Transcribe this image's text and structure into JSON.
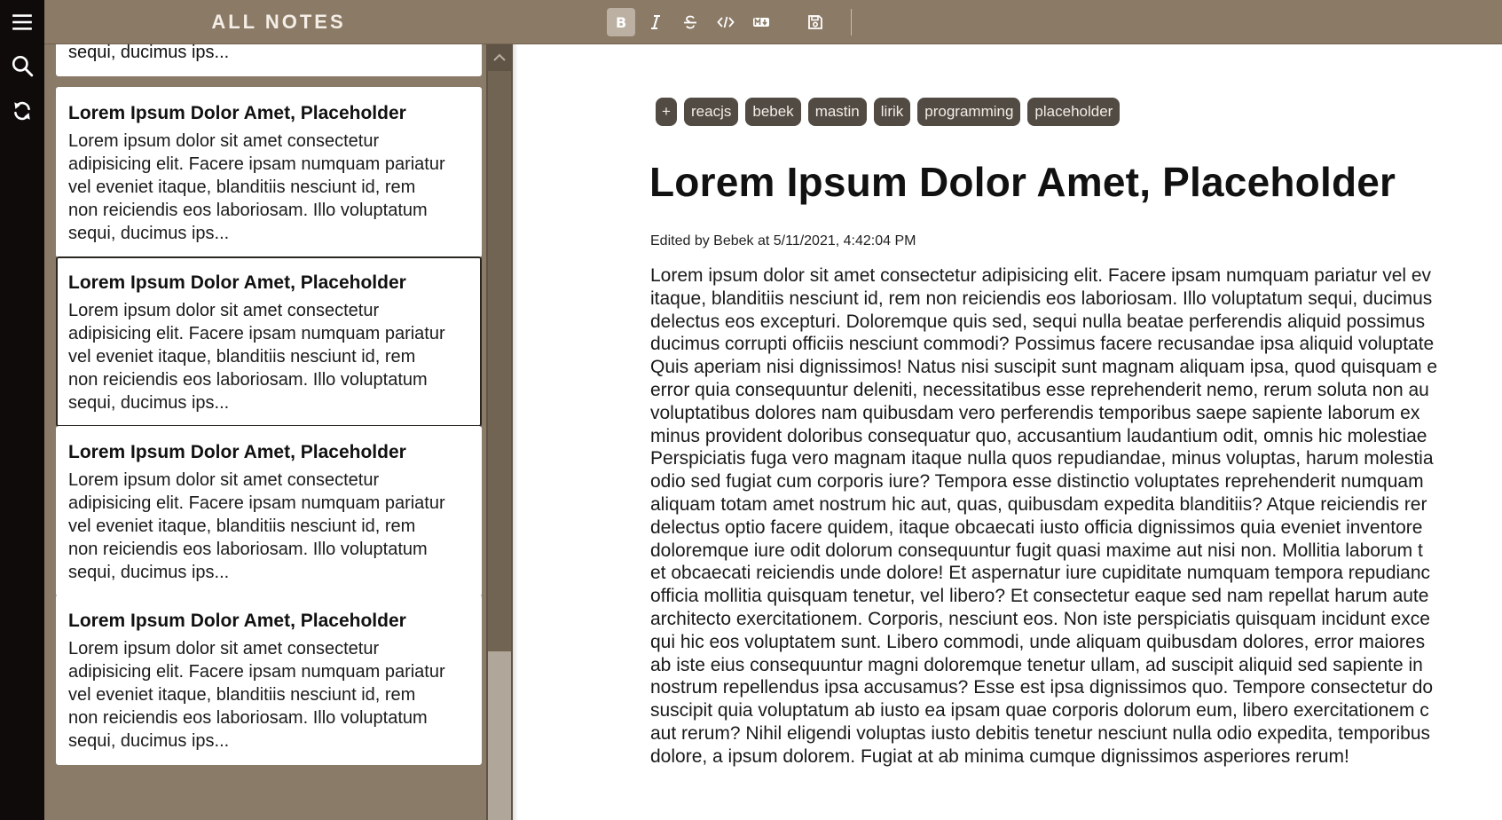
{
  "rail": {
    "icons": [
      "menu-icon",
      "search-icon",
      "sync-icon"
    ]
  },
  "list": {
    "title": "ALL NOTES",
    "partial_card_tail": "sequi, ducimus ips...",
    "cards": [
      {
        "title": "Lorem Ipsum Dolor Amet, Placeholder",
        "lines": [
          "Lorem ipsum dolor sit amet consectetur",
          "adipisicing elit. Facere ipsam numquam pariatur",
          "vel eveniet itaque, blanditiis nesciunt id, rem",
          "non reiciendis eos laboriosam. Illo voluptatum",
          "sequi, ducimus ips..."
        ],
        "active": false
      },
      {
        "title": "Lorem Ipsum Dolor Amet, Placeholder",
        "lines": [
          "Lorem ipsum dolor sit amet consectetur",
          "adipisicing elit. Facere ipsam numquam pariatur",
          "vel eveniet itaque, blanditiis nesciunt id, rem",
          "non reiciendis eos laboriosam. Illo voluptatum",
          "sequi, ducimus ips..."
        ],
        "active": true
      },
      {
        "title": "Lorem Ipsum Dolor Amet, Placeholder",
        "lines": [
          "Lorem ipsum dolor sit amet consectetur",
          "adipisicing elit. Facere ipsam numquam pariatur",
          "vel eveniet itaque, blanditiis nesciunt id, rem",
          "non reiciendis eos laboriosam. Illo voluptatum",
          "sequi, ducimus ips..."
        ],
        "active": false
      },
      {
        "title": "Lorem Ipsum Dolor Amet, Placeholder",
        "lines": [
          "Lorem ipsum dolor sit amet consectetur",
          "adipisicing elit. Facere ipsam numquam pariatur",
          "vel eveniet itaque, blanditiis nesciunt id, rem",
          "non reiciendis eos laboriosam. Illo voluptatum",
          "sequi, ducimus ips..."
        ],
        "active": false
      }
    ]
  },
  "toolbar": {
    "buttons": [
      {
        "name": "bold-button",
        "icon": "bold-icon",
        "active": true
      },
      {
        "name": "italic-button",
        "icon": "italic-icon",
        "active": false
      },
      {
        "name": "strikethrough-button",
        "icon": "strikethrough-icon",
        "active": false
      },
      {
        "name": "code-button",
        "icon": "code-icon",
        "active": false
      },
      {
        "name": "markdown-button",
        "icon": "markdown-icon",
        "active": false
      },
      {
        "name": "save-button",
        "icon": "save-icon",
        "active": false
      }
    ]
  },
  "editor": {
    "add_tag_label": "+",
    "tags": [
      "reacjs",
      "bebek",
      "mastin",
      "lirik",
      "programming",
      "placeholder"
    ],
    "title": "Lorem Ipsum Dolor Amet, Placeholder",
    "meta": "Edited by Bebek at 5/11/2021, 4:42:04 PM",
    "body_lines": [
      "Lorem ipsum dolor sit amet consectetur adipisicing elit. Facere ipsam numquam pariatur vel ev",
      "itaque, blanditiis nesciunt id, rem non reiciendis eos laboriosam. Illo voluptatum sequi, ducimus",
      "delectus eos excepturi. Doloremque quis sed, sequi nulla beatae perferendis aliquid possimus",
      "ducimus corrupti officiis nesciunt commodi? Possimus facere recusandae ipsa aliquid voluptate",
      "Quis aperiam nisi dignissimos! Natus nisi suscipit sunt magnam aliquam ipsa, quod quisquam e",
      "error quia consequuntur deleniti, necessitatibus esse reprehenderit nemo, rerum soluta non au",
      "voluptatibus dolores nam quibusdam vero perferendis temporibus saepe sapiente laborum ex",
      "minus provident doloribus consequatur quo, accusantium laudantium odit, omnis hic molestiae",
      "Perspiciatis fuga vero magnam itaque nulla quos repudiandae, minus voluptas, harum molestia",
      "odio sed fugiat cum corporis iure? Tempora esse distinctio voluptates reprehenderit numquam",
      "aliquam totam amet nostrum hic aut, quas, quibusdam expedita blanditiis? Atque reiciendis rer",
      "delectus optio facere quidem, itaque obcaecati iusto officia dignissimos quia eveniet inventore",
      "doloremque iure odit dolorum consequuntur fugit quasi maxime aut nisi non. Mollitia laborum t",
      "et obcaecati reiciendis unde dolore! Et aspernatur iure cupiditate numquam tempora repudianc",
      "officia mollitia quisquam tenetur, vel libero? Et consectetur eaque sed nam repellat harum aute",
      "architecto exercitationem. Corporis, nesciunt eos. Non iste perspiciatis quisquam incidunt exce",
      "qui hic eos voluptatem sunt. Libero commodi, unde aliquam quibusdam dolores, error maiores",
      "ab iste eius consequuntur magni doloremque tenetur ullam, ad suscipit aliquid sed sapiente in",
      "nostrum repellendus ipsa accusamus? Esse est ipsa dignissimos quo. Tempore consectetur do",
      "suscipit quia voluptatum ab iusto ea ipsam quae corporis dolorum eum, libero exercitationem c",
      "aut rerum? Nihil eligendi voluptas iusto debitis tenetur nesciunt nulla odio expedita, temporibus",
      "dolore, a ipsum dolorem. Fugiat at ab minima cumque dignissimos asperiores rerum!"
    ]
  },
  "colors": {
    "rail": "#0f0b0a",
    "panel": "#8b7a66",
    "tag": "#524b44",
    "active_toolbar_button": "#bbb0a2"
  }
}
